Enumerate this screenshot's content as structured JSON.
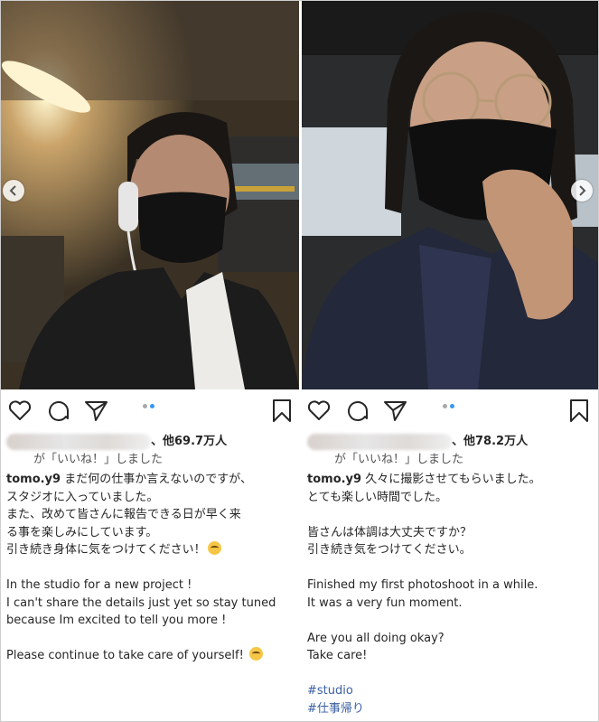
{
  "posts": [
    {
      "likes_suffix": "、他69.7万人",
      "liked_line": "が「いいね！」しました",
      "username": "tomo.y9",
      "caption_lines": [
        "まだ何の仕事か言えないのですが、",
        "スタジオに入っていました。",
        "また、改めて皆さんに報告できる日が早く来",
        "る事を楽しみにしています。",
        "引き続き身体に気をつけてください！",
        "",
        "In the studio for a new project !",
        "I can't share the details just yet so stay tuned",
        "because Im excited to tell you more !",
        "",
        "Please continue to take care of yourself!"
      ],
      "carousel_active_dot": 2
    },
    {
      "likes_suffix": "、他78.2万人",
      "liked_line": "が「いいね！」しました",
      "username": "tomo.y9",
      "caption_lines": [
        "久々に撮影させてもらいました。",
        "とても楽しい時間でした。",
        "",
        "皆さんは体調は大丈夫ですか？",
        "引き続き気をつけてください。",
        "",
        "Finished my first photoshoot in a while.",
        "It was a very fun moment.",
        "",
        "Are you all doing okay?",
        "Take care!",
        ""
      ],
      "hashtags": [
        "#studio",
        "#仕事帰り"
      ],
      "carousel_active_dot": 2
    }
  ],
  "icons": [
    "heart-icon",
    "comment-icon",
    "share-icon",
    "bookmark-icon",
    "chevron-left-icon",
    "chevron-right-icon"
  ],
  "colors": {
    "dot_active": "#3897f0",
    "dot_inactive": "#a8a8a8",
    "hashtag": "#3b5fa3",
    "text": "#262626"
  }
}
